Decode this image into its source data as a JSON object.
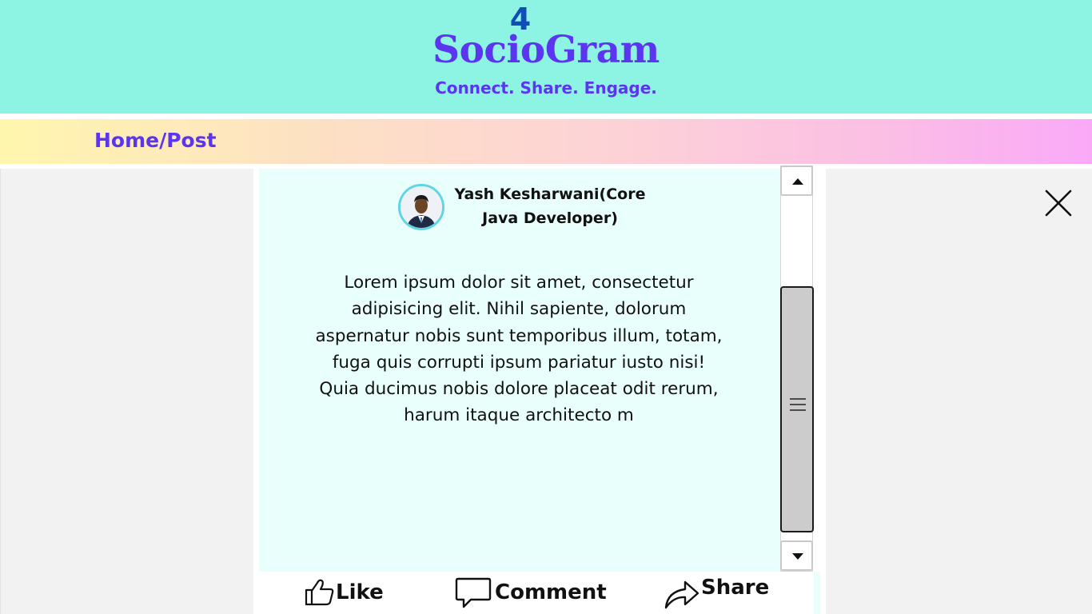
{
  "header": {
    "logo_mark": "4",
    "app_title": "SocioGram",
    "tagline": "Connect. Share. Engage."
  },
  "nav": {
    "breadcrumb": "Home/Post"
  },
  "post": {
    "author_line1": "Yash Kesharwani(Core",
    "author_line2": "Java Developer)",
    "body_lines": [
      "Lorem ipsum dolor sit amet, consectetur",
      "adipisicing elit. Nihil sapiente, dolorum",
      "aspernatur nobis sunt temporibus illum, totam,",
      "fuga quis corrupti ipsum pariatur iusto nisi!",
      "Quia ducimus nobis dolore placeat odit rerum,",
      "harum itaque architecto m"
    ]
  },
  "actions": {
    "like": "Like",
    "comment": "Comment",
    "share": "Share"
  },
  "icons": {
    "close": "close-icon",
    "like": "thumbs-up-icon",
    "comment": "speech-bubble-icon",
    "share": "share-arrow-icon",
    "scroll_up": "triangle-up-icon",
    "scroll_down": "triangle-down-icon",
    "scroll_grip": "hamburger-icon"
  },
  "colors": {
    "header_bg": "#8df3e2",
    "brand_purple": "#5b35ef",
    "logo_blue": "#0f4fb5",
    "card_bg": "#e8fffb",
    "side_bg": "#f2f2f2",
    "avatar_ring": "#5ed6e3"
  }
}
